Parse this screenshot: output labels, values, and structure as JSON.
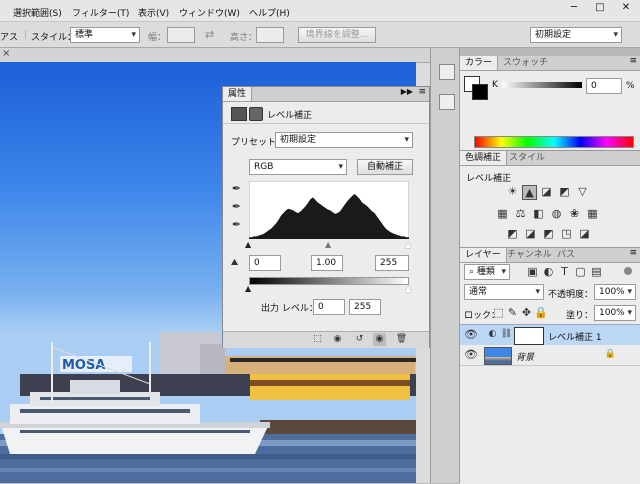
{
  "menu": [
    "選択範囲(S)",
    "フィルター(T)",
    "表示(V)",
    "ウィンドウ(W)",
    "ヘルプ(H)"
  ],
  "window_controls": {
    "minimize": "─",
    "maximize": "□",
    "close": "✕"
  },
  "options": {
    "partial_label": "アス",
    "style_label": "スタイル：",
    "style_value": "標準",
    "width_label": "幅：",
    "height_label": "高さ：",
    "refine_edge": "境界線を調整...",
    "workspace": "初期設定"
  },
  "properties": {
    "title": "属性",
    "header": "レベル補正",
    "preset_label": "プリセット：",
    "preset_value": "初期設定",
    "channel": "RGB",
    "auto": "自動補正",
    "input_black": "0",
    "input_gamma": "1.00",
    "input_white": "255",
    "output_label": "出力 レベル：",
    "output_black": "0",
    "output_white": "255"
  },
  "color_panel": {
    "tabs": [
      "カラー",
      "スウォッチ"
    ],
    "channel": "K",
    "value": "0",
    "unit": "%"
  },
  "adjustments_panel": {
    "tabs": [
      "色調補正",
      "スタイル"
    ],
    "hint": "レベル補正"
  },
  "layers_panel": {
    "tabs": [
      "レイヤー",
      "チャンネル",
      "パス"
    ],
    "filter_kind": "種類",
    "blend_mode": "通常",
    "opacity_label": "不透明度：",
    "opacity_value": "100%",
    "lock_label": "ロック：",
    "fill_label": "塗り：",
    "fill_value": "100%",
    "layers": [
      {
        "name": "レベル補正 1",
        "selected": true
      },
      {
        "name": "背景",
        "selected": false
      }
    ]
  },
  "scene_sign": "MOSA",
  "colors": {
    "accent": "#1f6fd0",
    "selection": "#bcd6f6",
    "panel": "#ececec"
  },
  "histogram": [
    2,
    2,
    3,
    3,
    4,
    5,
    6,
    8,
    10,
    12,
    15,
    18,
    22,
    27,
    30,
    33,
    35,
    34,
    33,
    31,
    30,
    32,
    35,
    38,
    42,
    46,
    48,
    45,
    42,
    40,
    38,
    36,
    34,
    33,
    31,
    29,
    30,
    32,
    36,
    40,
    44,
    47,
    50,
    52,
    49,
    46,
    42,
    40,
    38,
    35,
    32,
    30,
    26,
    22,
    18,
    14,
    11,
    9,
    7,
    6,
    5,
    4,
    3,
    3,
    2,
    2
  ]
}
